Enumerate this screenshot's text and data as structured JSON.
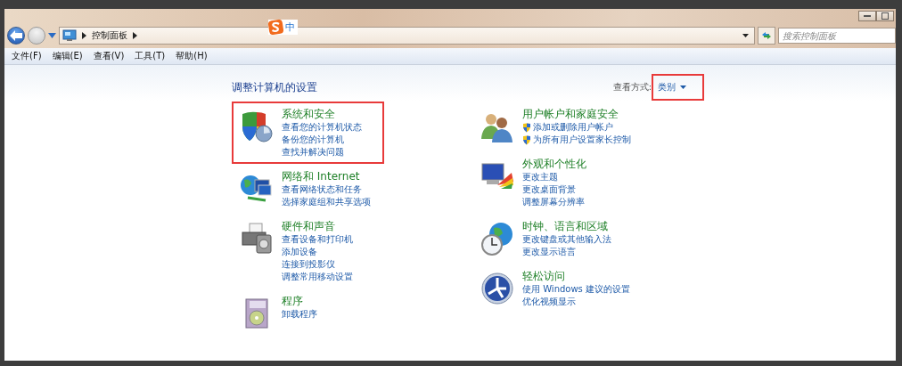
{
  "address_bar": {
    "path": [
      "控制面板"
    ]
  },
  "ime_indicator": {
    "label": "中"
  },
  "search": {
    "placeholder": "搜索控制面板"
  },
  "menu": [
    "文件(F)",
    "编辑(E)",
    "查看(V)",
    "工具(T)",
    "帮助(H)"
  ],
  "heading": "调整计算机的设置",
  "view_by": {
    "label": "查看方式:",
    "value": "类别",
    "highlighted": true
  },
  "columns": [
    [
      {
        "title": "系统和安全",
        "highlighted": true,
        "links": [
          {
            "text": "查看您的计算机状态",
            "kind": "plain"
          },
          {
            "text": "备份您的计算机",
            "kind": "plain"
          },
          {
            "text": "查找并解决问题",
            "kind": "plain"
          }
        ]
      },
      {
        "title": "网络和 Internet",
        "highlighted": false,
        "links": [
          {
            "text": "查看网络状态和任务",
            "kind": "plain"
          },
          {
            "text": "选择家庭组和共享选项",
            "kind": "plain"
          }
        ]
      },
      {
        "title": "硬件和声音",
        "highlighted": false,
        "links": [
          {
            "text": "查看设备和打印机",
            "kind": "plain"
          },
          {
            "text": "添加设备",
            "kind": "plain"
          },
          {
            "text": "连接到投影仪",
            "kind": "plain"
          },
          {
            "text": "调整常用移动设置",
            "kind": "plain"
          }
        ]
      },
      {
        "title": "程序",
        "highlighted": false,
        "links": [
          {
            "text": "卸载程序",
            "kind": "plain"
          }
        ]
      }
    ],
    [
      {
        "title": "用户帐户和家庭安全",
        "highlighted": false,
        "links": [
          {
            "text": "添加或删除用户帐户",
            "kind": "shield"
          },
          {
            "text": "为所有用户设置家长控制",
            "kind": "shield"
          }
        ]
      },
      {
        "title": "外观和个性化",
        "highlighted": false,
        "links": [
          {
            "text": "更改主题",
            "kind": "plain"
          },
          {
            "text": "更改桌面背景",
            "kind": "plain"
          },
          {
            "text": "调整屏幕分辨率",
            "kind": "plain"
          }
        ]
      },
      {
        "title": "时钟、语言和区域",
        "highlighted": false,
        "links": [
          {
            "text": "更改键盘或其他输入法",
            "kind": "plain"
          },
          {
            "text": "更改显示语言",
            "kind": "plain"
          }
        ]
      },
      {
        "title": "轻松访问",
        "highlighted": false,
        "links": [
          {
            "text": "使用 Windows 建议的设置",
            "kind": "plain"
          },
          {
            "text": "优化视频显示",
            "kind": "plain"
          }
        ]
      }
    ]
  ]
}
